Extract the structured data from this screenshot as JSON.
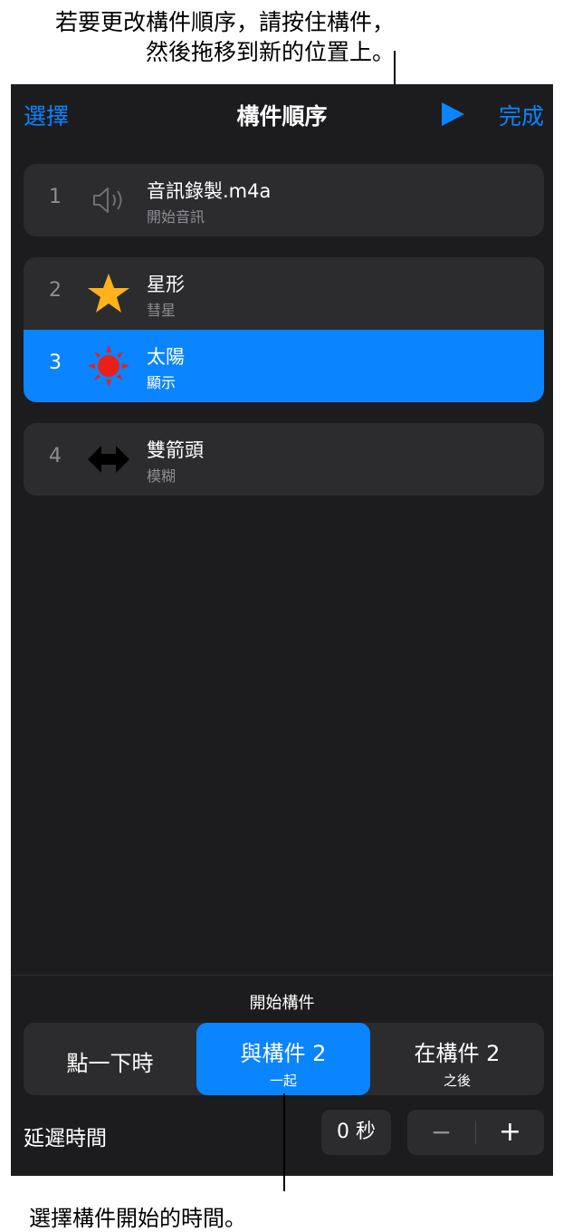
{
  "callouts": {
    "top_line1": "若要更改構件順序，請按住構件，",
    "top_line2": "然後拖移到新的位置上。",
    "bottom": "選擇構件開始的時間。"
  },
  "nav": {
    "select": "選擇",
    "title": "構件順序",
    "done": "完成"
  },
  "builds": [
    {
      "number": "1",
      "title": "音訊錄製.m4a",
      "subtitle": "開始音訊",
      "icon": "speaker-icon"
    },
    {
      "number": "2",
      "title": "星形",
      "subtitle": "彗星",
      "icon": "star-icon"
    },
    {
      "number": "3",
      "title": "太陽",
      "subtitle": "顯示",
      "icon": "sun-icon"
    },
    {
      "number": "4",
      "title": "雙箭頭",
      "subtitle": "模糊",
      "icon": "double-arrow-icon"
    }
  ],
  "start_build": {
    "title": "開始構件",
    "options": [
      {
        "label": "點一下時",
        "sub": ""
      },
      {
        "label": "與構件 2",
        "sub": "一起"
      },
      {
        "label": "在構件 2",
        "sub": "之後"
      }
    ],
    "selected_index": 1
  },
  "delay": {
    "label": "延遲時間",
    "value": "0 秒",
    "minus": "−",
    "plus": "+"
  },
  "colors": {
    "accent": "#0a84ff",
    "panel": "#1c1c1e",
    "row": "#2c2c2e",
    "star": "#ffb21c",
    "sun": "#e8201a"
  }
}
